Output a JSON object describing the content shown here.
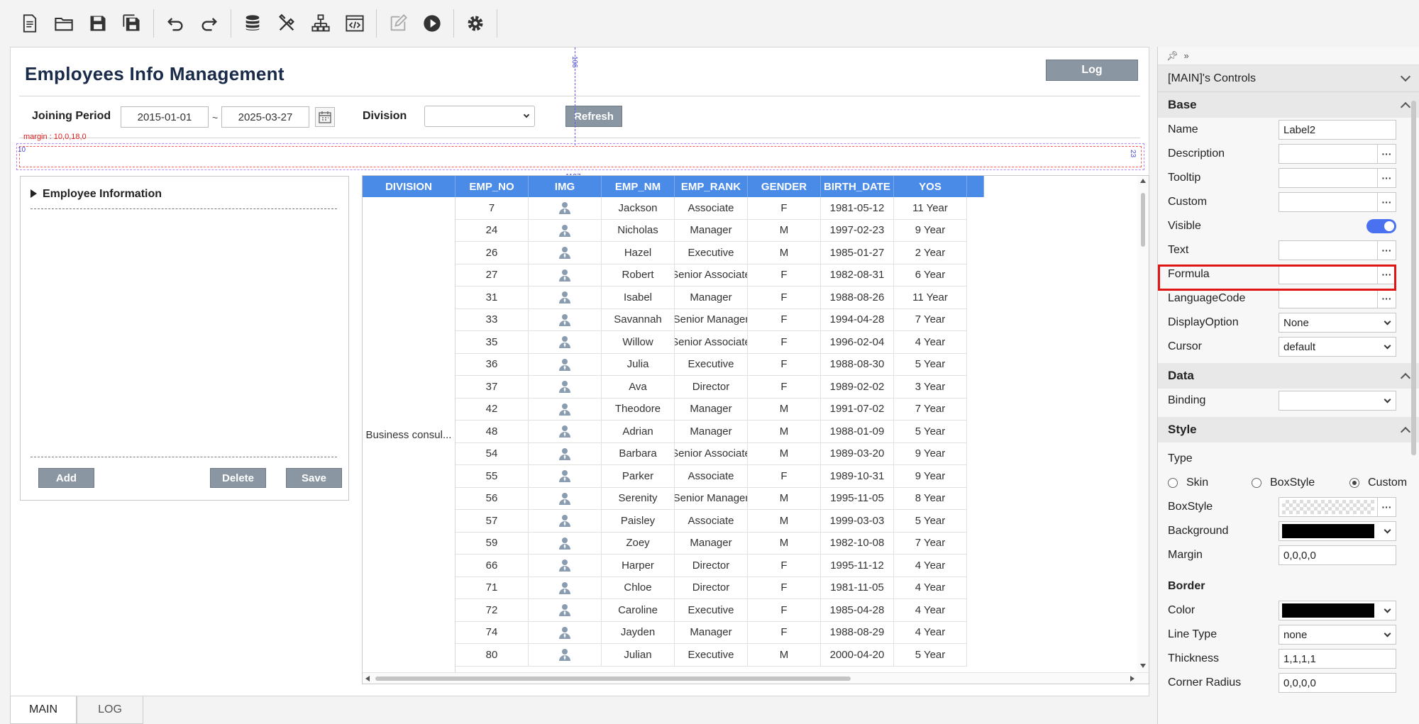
{
  "toolbar": {
    "icons": [
      "new-document-icon",
      "open-folder-icon",
      "save-icon",
      "save-all-icon",
      "undo-icon",
      "redo-icon",
      "database-icon",
      "tools-icon",
      "hierarchy-icon",
      "code-view-icon",
      "edit-icon",
      "run-icon",
      "settings-icon"
    ]
  },
  "designer": {
    "title": "Employees Info Management",
    "log_button": "Log",
    "joining_period_label": "Joining Period",
    "date_from": "2015-01-01",
    "tilde": "~",
    "date_to": "2025-03-27",
    "division_label": "Division",
    "division_value": "",
    "refresh_button": "Refresh",
    "guide_top": "106",
    "margin_note": "margin : 10,0,18,0",
    "guide_left": "10",
    "guide_right": "23",
    "guide_width": "1197"
  },
  "info_panel": {
    "title": "Employee Information",
    "add_button": "Add",
    "delete_button": "Delete",
    "save_button": "Save"
  },
  "grid": {
    "columns": [
      "DIVISION",
      "EMP_NO",
      "IMG",
      "EMP_NM",
      "EMP_RANK",
      "GENDER",
      "BIRTH_DATE",
      "YOS"
    ],
    "division_value": "Business consul...",
    "rows": [
      {
        "emp_no": "7",
        "name": "Jackson",
        "rank": "Associate",
        "gender": "F",
        "birth": "1981-05-12",
        "yos": "11 Year"
      },
      {
        "emp_no": "24",
        "name": "Nicholas",
        "rank": "Manager",
        "gender": "M",
        "birth": "1997-02-23",
        "yos": "9 Year"
      },
      {
        "emp_no": "26",
        "name": "Hazel",
        "rank": "Executive",
        "gender": "M",
        "birth": "1985-01-27",
        "yos": "2 Year"
      },
      {
        "emp_no": "27",
        "name": "Robert",
        "rank": "Senior Associate",
        "gender": "F",
        "birth": "1982-08-31",
        "yos": "6 Year"
      },
      {
        "emp_no": "31",
        "name": "Isabel",
        "rank": "Manager",
        "gender": "F",
        "birth": "1988-08-26",
        "yos": "11 Year"
      },
      {
        "emp_no": "33",
        "name": "Savannah",
        "rank": "Senior Manager",
        "gender": "F",
        "birth": "1994-04-28",
        "yos": "7 Year"
      },
      {
        "emp_no": "35",
        "name": "Willow",
        "rank": "Senior Associate",
        "gender": "F",
        "birth": "1996-02-04",
        "yos": "4 Year"
      },
      {
        "emp_no": "36",
        "name": "Julia",
        "rank": "Executive",
        "gender": "F",
        "birth": "1988-08-30",
        "yos": "5 Year"
      },
      {
        "emp_no": "37",
        "name": "Ava",
        "rank": "Director",
        "gender": "F",
        "birth": "1989-02-02",
        "yos": "3 Year"
      },
      {
        "emp_no": "42",
        "name": "Theodore",
        "rank": "Manager",
        "gender": "M",
        "birth": "1991-07-02",
        "yos": "7 Year"
      },
      {
        "emp_no": "48",
        "name": "Adrian",
        "rank": "Manager",
        "gender": "M",
        "birth": "1988-01-09",
        "yos": "5 Year"
      },
      {
        "emp_no": "54",
        "name": "Barbara",
        "rank": "Senior Associate",
        "gender": "M",
        "birth": "1989-03-20",
        "yos": "9 Year"
      },
      {
        "emp_no": "55",
        "name": "Parker",
        "rank": "Associate",
        "gender": "F",
        "birth": "1989-10-31",
        "yos": "9 Year"
      },
      {
        "emp_no": "56",
        "name": "Serenity",
        "rank": "Senior Manager",
        "gender": "M",
        "birth": "1995-11-05",
        "yos": "8 Year"
      },
      {
        "emp_no": "57",
        "name": "Paisley",
        "rank": "Associate",
        "gender": "M",
        "birth": "1999-03-03",
        "yos": "5 Year"
      },
      {
        "emp_no": "59",
        "name": "Zoey",
        "rank": "Manager",
        "gender": "M",
        "birth": "1982-10-08",
        "yos": "7 Year"
      },
      {
        "emp_no": "66",
        "name": "Harper",
        "rank": "Director",
        "gender": "F",
        "birth": "1995-11-12",
        "yos": "4 Year"
      },
      {
        "emp_no": "71",
        "name": "Chloe",
        "rank": "Director",
        "gender": "F",
        "birth": "1981-11-05",
        "yos": "4 Year"
      },
      {
        "emp_no": "72",
        "name": "Caroline",
        "rank": "Executive",
        "gender": "F",
        "birth": "1985-04-28",
        "yos": "4 Year"
      },
      {
        "emp_no": "74",
        "name": "Jayden",
        "rank": "Manager",
        "gender": "F",
        "birth": "1988-08-29",
        "yos": "4 Year"
      },
      {
        "emp_no": "80",
        "name": "Julian",
        "rank": "Executive",
        "gender": "M",
        "birth": "2000-04-20",
        "yos": "5 Year"
      }
    ]
  },
  "tabs": [
    "MAIN",
    "LOG"
  ],
  "props": {
    "topbar": "✐ »",
    "header": "[MAIN]'s Controls",
    "sections": {
      "base": "Base",
      "data": "Data",
      "style": "Style",
      "border": "Border"
    },
    "base": {
      "name_label": "Name",
      "name_value": "Label2",
      "description_label": "Description",
      "tooltip_label": "Tooltip",
      "custom_label": "Custom",
      "visible_label": "Visible",
      "text_label": "Text",
      "formula_label": "Formula",
      "languagecode_label": "LanguageCode",
      "displayoption_label": "DisplayOption",
      "displayoption_value": "None",
      "cursor_label": "Cursor",
      "cursor_value": "default"
    },
    "data": {
      "binding_label": "Binding",
      "binding_value": ""
    },
    "style": {
      "type_label": "Type",
      "skin_label": "Skin",
      "boxstyle_radio_label": "BoxStyle",
      "custom_radio_label": "Custom",
      "boxstyle_label": "BoxStyle",
      "background_label": "Background",
      "margin_label": "Margin",
      "margin_value": "0,0,0,0"
    },
    "border": {
      "color_label": "Color",
      "linetype_label": "Line Type",
      "linetype_value": "none",
      "thickness_label": "Thickness",
      "thickness_value": "1,1,1,1",
      "cornerradius_label": "Corner Radius",
      "cornerradius_value": "0,0,0,0"
    },
    "colors": {
      "background_color": "#000000",
      "border_color": "#000000",
      "highlight": "#e01515",
      "header_blue": "#4a8be8"
    }
  }
}
